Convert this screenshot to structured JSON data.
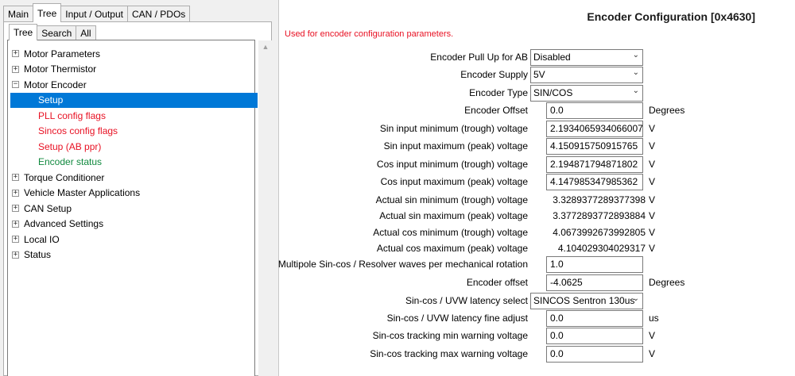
{
  "left": {
    "top_tabs": [
      "Main",
      "Tree",
      "Input / Output",
      "CAN / PDOs"
    ],
    "sub_tabs": [
      "Tree",
      "Search",
      "All"
    ],
    "tree": [
      {
        "label": "Motor Parameters",
        "expander": "+"
      },
      {
        "label": "Motor Thermistor",
        "expander": "+"
      },
      {
        "label": "Motor Encoder",
        "expander": "−"
      },
      {
        "label": "Setup",
        "child": true,
        "state": "selected"
      },
      {
        "label": "PLL config flags",
        "child": true,
        "state": "red"
      },
      {
        "label": "Sincos config flags",
        "child": true,
        "state": "red"
      },
      {
        "label": "Setup (AB ppr)",
        "child": true,
        "state": "red"
      },
      {
        "label": "Encoder status",
        "child": true,
        "state": "green"
      },
      {
        "label": "Torque Conditioner",
        "expander": "+"
      },
      {
        "label": "Vehicle Master Applications",
        "expander": "+"
      },
      {
        "label": "CAN Setup",
        "expander": "+"
      },
      {
        "label": "Advanced Settings",
        "expander": "+"
      },
      {
        "label": "Local IO",
        "expander": "+"
      },
      {
        "label": "Status",
        "expander": "+"
      }
    ]
  },
  "right": {
    "title": "Encoder Configuration [0x4630]",
    "description": "Used for encoder configuration parameters.",
    "params": [
      {
        "label": "Encoder Pull Up for AB",
        "kind": "select",
        "value": "Disabled",
        "unit": ""
      },
      {
        "label": "Encoder Supply",
        "kind": "select",
        "value": "5V",
        "unit": ""
      },
      {
        "label": "Encoder Type",
        "kind": "select",
        "value": "SIN/COS",
        "unit": ""
      },
      {
        "label": "Encoder Offset",
        "kind": "input",
        "value": "0.0",
        "unit": "Degrees"
      },
      {
        "label": "Sin input minimum (trough) voltage",
        "kind": "input",
        "value": "2.1934065934066007",
        "unit": "V"
      },
      {
        "label": "Sin input maximum (peak) voltage",
        "kind": "input",
        "value": "4.150915750915765",
        "unit": "V"
      },
      {
        "label": "Cos input minimum (trough) voltage",
        "kind": "input",
        "value": "2.194871794871802",
        "unit": "V"
      },
      {
        "label": "Cos input maximum (peak) voltage",
        "kind": "input",
        "value": "4.147985347985362",
        "unit": "V"
      },
      {
        "label": "Actual sin minimum (trough) voltage",
        "kind": "readonly",
        "value": "3.3289377289377398",
        "unit": "V"
      },
      {
        "label": "Actual sin maximum (peak) voltage",
        "kind": "readonly",
        "value": "3.3772893772893884",
        "unit": "V"
      },
      {
        "label": "Actual cos minimum (trough) voltage",
        "kind": "readonly",
        "value": "4.0673992673992805",
        "unit": "V"
      },
      {
        "label": "Actual cos maximum (peak) voltage",
        "kind": "readonly",
        "value": "4.104029304029317",
        "unit": "V"
      },
      {
        "label": "Multipole Sin-cos / Resolver waves per mechanical rotation",
        "kind": "input",
        "value": "1.0",
        "unit": ""
      },
      {
        "label": "Encoder offset",
        "kind": "input",
        "value": "-4.0625",
        "unit": "Degrees"
      },
      {
        "label": "Sin-cos / UVW latency select",
        "kind": "select",
        "value": "SINCOS Sentron 130us",
        "unit": ""
      },
      {
        "label": "Sin-cos / UVW latency fine adjust",
        "kind": "input",
        "value": "0.0",
        "unit": "us"
      },
      {
        "label": "Sin-cos tracking min warning voltage",
        "kind": "input",
        "value": "0.0",
        "unit": "V"
      },
      {
        "label": "Sin-cos tracking max warning voltage",
        "kind": "input",
        "value": "0.0",
        "unit": "V"
      }
    ]
  }
}
